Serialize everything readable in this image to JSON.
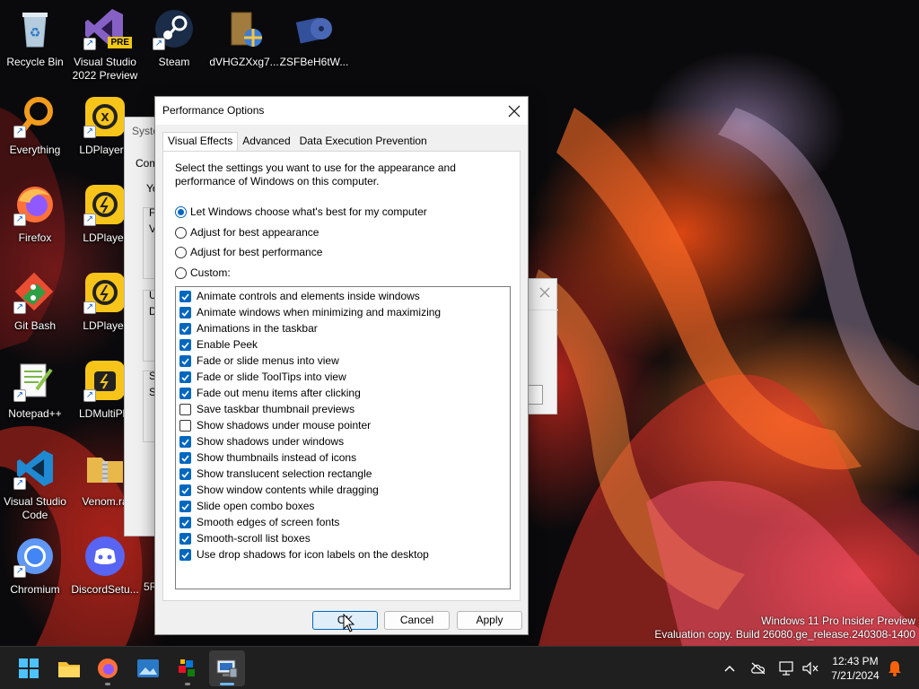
{
  "desktop": {
    "icons": [
      {
        "label": "Recycle Bin"
      },
      {
        "label": "Visual Studio 2022 Preview",
        "badge": "PRE"
      },
      {
        "label": "Steam"
      },
      {
        "label": "dVHGZXxg7..."
      },
      {
        "label": "ZSFBeH6tW..."
      },
      {
        "label": "Everything"
      },
      {
        "label": "LDPlayerX"
      },
      {
        "label": "Firefox"
      },
      {
        "label": "LDPlayer"
      },
      {
        "label": "Git Bash"
      },
      {
        "label": "LDPlayer"
      },
      {
        "label": "Notepad++"
      },
      {
        "label": "LDMultiPla"
      },
      {
        "label": "Visual Studio Code"
      },
      {
        "label": "Venom.ra"
      },
      {
        "label": "Chromium"
      },
      {
        "label": "DiscordSetu..."
      }
    ],
    "partial_text": "5R"
  },
  "background_dialog": {
    "title_fragment": "Syste",
    "tab_fragment": "Com",
    "text_fragments": [
      "Yo",
      "F",
      "V",
      "U",
      "D",
      "S",
      "S"
    ]
  },
  "dialog": {
    "title": "Performance Options",
    "tabs": [
      {
        "label": "Visual Effects",
        "active": true
      },
      {
        "label": "Advanced",
        "active": false
      },
      {
        "label": "Data Execution Prevention",
        "active": false
      }
    ],
    "intro": "Select the settings you want to use for the appearance and performance of Windows on this computer.",
    "radios": [
      {
        "label": "Let Windows choose what's best for my computer",
        "checked": true
      },
      {
        "label": "Adjust for best appearance",
        "checked": false
      },
      {
        "label": "Adjust for best performance",
        "checked": false
      },
      {
        "label": "Custom:",
        "checked": false
      }
    ],
    "effects": [
      {
        "label": "Animate controls and elements inside windows",
        "checked": true
      },
      {
        "label": "Animate windows when minimizing and maximizing",
        "checked": true
      },
      {
        "label": "Animations in the taskbar",
        "checked": true
      },
      {
        "label": "Enable Peek",
        "checked": true
      },
      {
        "label": "Fade or slide menus into view",
        "checked": true
      },
      {
        "label": "Fade or slide ToolTips into view",
        "checked": true
      },
      {
        "label": "Fade out menu items after clicking",
        "checked": true
      },
      {
        "label": "Save taskbar thumbnail previews",
        "checked": false
      },
      {
        "label": "Show shadows under mouse pointer",
        "checked": false
      },
      {
        "label": "Show shadows under windows",
        "checked": true
      },
      {
        "label": "Show thumbnails instead of icons",
        "checked": true
      },
      {
        "label": "Show translucent selection rectangle",
        "checked": true
      },
      {
        "label": "Show window contents while dragging",
        "checked": true
      },
      {
        "label": "Slide open combo boxes",
        "checked": true
      },
      {
        "label": "Smooth edges of screen fonts",
        "checked": true
      },
      {
        "label": "Smooth-scroll list boxes",
        "checked": true
      },
      {
        "label": "Use drop shadows for icon labels on the desktop",
        "checked": true
      }
    ],
    "buttons": {
      "ok": "OK",
      "cancel": "Cancel",
      "apply": "Apply"
    }
  },
  "watermark": {
    "line1": "Windows 11 Pro Insider Preview",
    "line2": "Evaluation copy. Build 26080.ge_release.240308-1400"
  },
  "taskbar": {
    "apps": [
      "start-icon",
      "file-explorer-icon",
      "firefox-icon",
      "photos-icon",
      "paint-icon",
      "system-properties-icon"
    ],
    "time": "12:43 PM",
    "date": "7/21/2024"
  },
  "colors": {
    "accent": "#0067c0",
    "taskbar_bg": "#1f1f1f",
    "dialog_bg": "#f0f0f0"
  }
}
